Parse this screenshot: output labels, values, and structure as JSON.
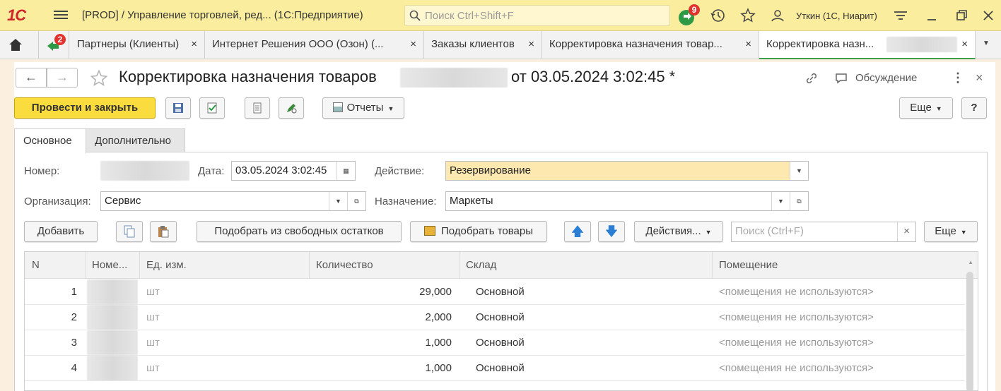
{
  "topbar": {
    "logo": "1С",
    "title": "[PROD] / Управление торговлей, ред...  (1С:Предприятие)",
    "search_placeholder": "Поиск Ctrl+Shift+F",
    "notifications_count": "9",
    "user": "Уткин (1С, Ниарит)"
  },
  "tabs": {
    "alerts_count": "2",
    "items": [
      {
        "label": "Партнеры (Клиенты)"
      },
      {
        "label": "Интернет Решения ООО (Озон) (..."
      },
      {
        "label": "Заказы клиентов"
      },
      {
        "label": "Корректировка назначения товар..."
      },
      {
        "label": "Корректировка назн..."
      }
    ],
    "close": "×"
  },
  "document": {
    "title_prefix": "Корректировка назначения товаров",
    "title_suffix": "от 03.05.2024 3:02:45 *",
    "discussion": "Обсуждение"
  },
  "toolbar": {
    "post_close": "Провести и закрыть",
    "reports": "Отчеты",
    "more": "Еще",
    "help": "?"
  },
  "form_tabs": {
    "main": "Основное",
    "extra": "Дополнительно"
  },
  "form": {
    "number_label": "Номер:",
    "date_label": "Дата:",
    "date_value": "03.05.2024  3:02:45",
    "action_label": "Действие:",
    "action_value": "Резервирование",
    "org_label": "Организация:",
    "org_value": "Сервис",
    "purpose_label": "Назначение:",
    "purpose_value": "Маркеты"
  },
  "table_toolbar": {
    "add": "Добавить",
    "pick_free": "Подобрать из свободных остатков",
    "pick_goods": "Подобрать товары",
    "actions": "Действия...",
    "search_placeholder": "Поиск (Ctrl+F)",
    "clear": "×",
    "more": "Еще"
  },
  "table": {
    "headers": [
      "N",
      "Номе...",
      "Ед. изм.",
      "Количество",
      "Склад",
      "Помещение"
    ],
    "rows": [
      {
        "n": "1",
        "unit": "шт",
        "qty": "29,000",
        "warehouse": "Основной",
        "room": "<помещения не используются>"
      },
      {
        "n": "2",
        "unit": "шт",
        "qty": "2,000",
        "warehouse": "Основной",
        "room": "<помещения не используются>"
      },
      {
        "n": "3",
        "unit": "шт",
        "qty": "1,000",
        "warehouse": "Основной",
        "room": "<помещения не используются>"
      },
      {
        "n": "4",
        "unit": "шт",
        "qty": "1,000",
        "warehouse": "Основной",
        "room": "<помещения не используются>"
      }
    ]
  },
  "colors": {
    "accent_yellow": "#fbdc3e",
    "topbar": "#fbed9e",
    "highlight_field": "#fde9b0",
    "active_tab": "#3aa04b",
    "badge": "#e2322d"
  }
}
